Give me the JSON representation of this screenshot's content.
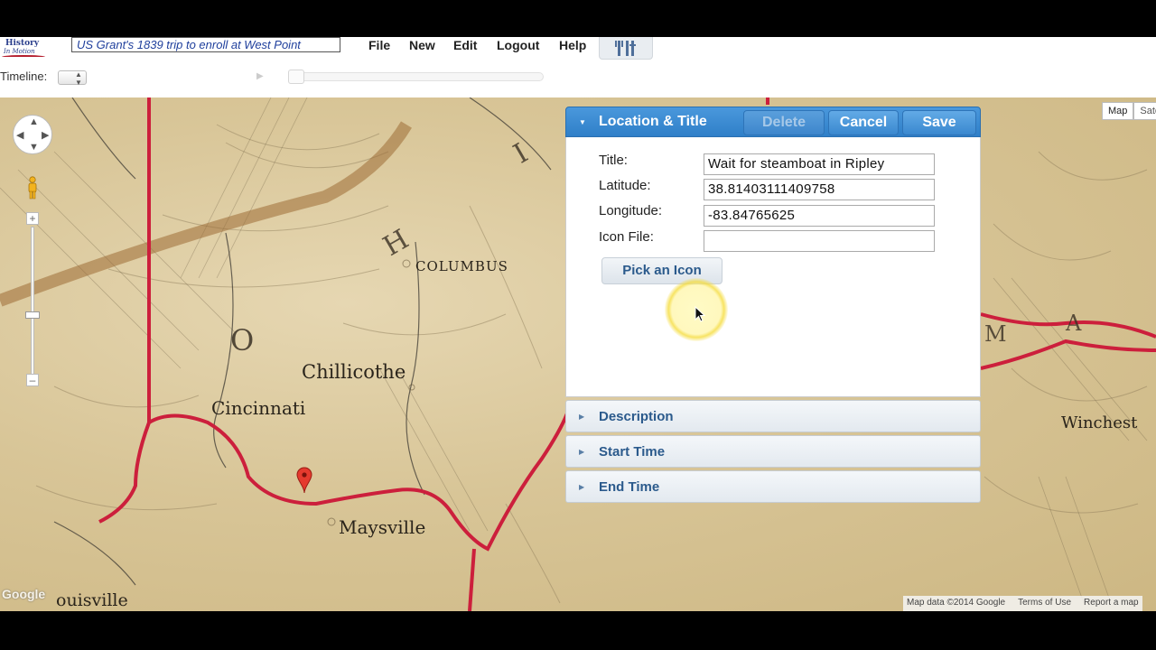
{
  "toolbar": {
    "logo_line1": "History",
    "logo_line2": "In Motion",
    "trip_title": "US Grant's 1839 trip to enroll at West Point",
    "menu": {
      "file": "File",
      "new": "New",
      "edit": "Edit",
      "logout": "Logout",
      "help": "Help"
    },
    "tools_icon": "tools-icon"
  },
  "timeline": {
    "label": "Timeline:",
    "select_icon": "updown-arrows-icon",
    "play_icon": "play-icon",
    "slider_value": 0
  },
  "map": {
    "town_labels": {
      "columbus": "COLUMBUS",
      "chillicothe": "Chillicothe",
      "cincinnati": "Cincinnati",
      "maysville": "Maysville",
      "louisville": "ouisville",
      "winchester": "Winchest"
    },
    "map_type": {
      "map": "Map",
      "satellite": "Sate"
    },
    "google_logo": "Google",
    "attribution": {
      "data": "Map data ©2014 Google",
      "terms": "Terms of Use",
      "report": "Report a map"
    },
    "marker_icon": "map-pin-icon",
    "route_color": "#cc1f3c"
  },
  "panel": {
    "header": {
      "title": "Location & Title",
      "delete_label": "Delete",
      "cancel_label": "Cancel",
      "save_label": "Save"
    },
    "fields": {
      "title_label": "Title:",
      "title_value": "Wait for steamboat in Ripley",
      "latitude_label": "Latitude:",
      "latitude_value": "38.81403111409758",
      "longitude_label": "Longitude:",
      "longitude_value": "-83.84765625",
      "icon_file_label": "Icon File:",
      "icon_file_value": ""
    },
    "pick_icon_label": "Pick an Icon",
    "sections": {
      "description": "Description",
      "start_time": "Start Time",
      "end_time": "End Time"
    },
    "accent_color": "#3a88cf"
  }
}
